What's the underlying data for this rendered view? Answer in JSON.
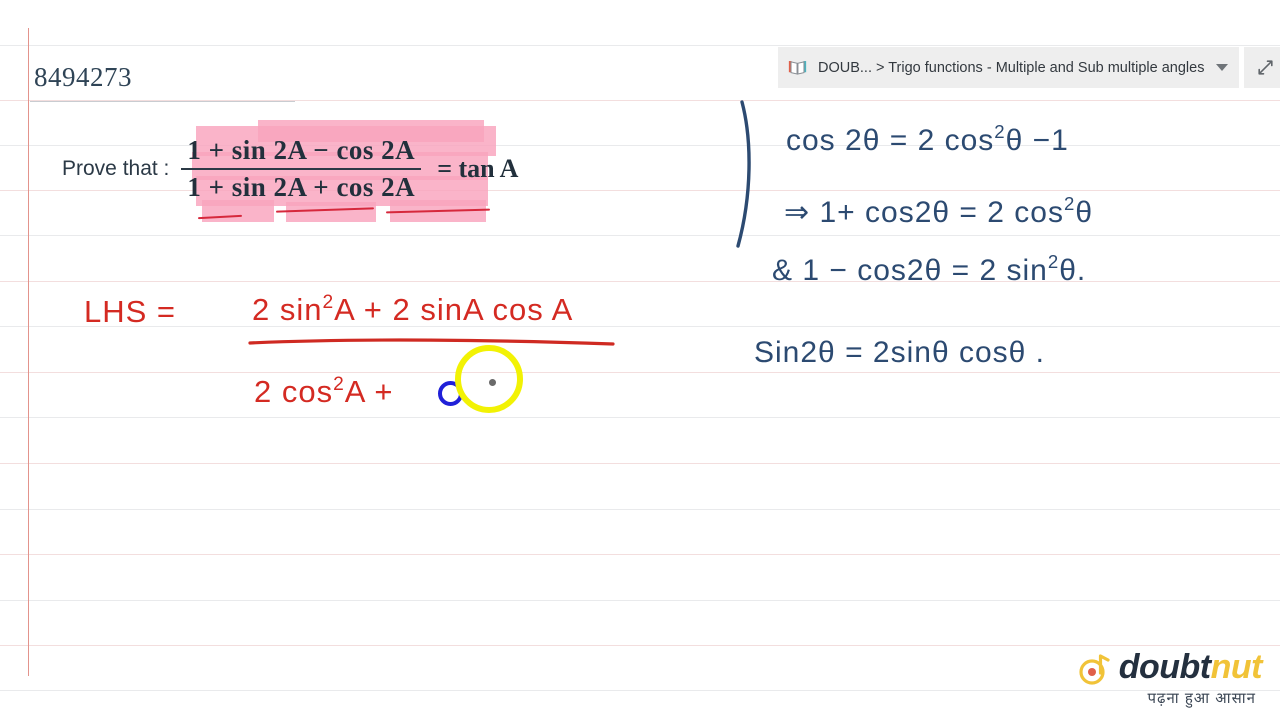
{
  "page": {
    "question_id": "8494273",
    "background": "#ffffff",
    "margin_line_color": "#e3938c",
    "rule_line_color": "#e9eaec"
  },
  "question": {
    "prove_label": "Prove that :",
    "numerator": "1 + sin 2A − cos 2A",
    "denominator": "1 + sin 2A + cos 2A",
    "right_side": "= tan A",
    "highlight_color": "#f9a3bd",
    "underline_color": "#d6283c"
  },
  "toolbar": {
    "book_icon": "book-icon",
    "breadcrumb": "DOUB... > Trigo functions - Multiple and Sub multiple angles",
    "caret_icon": "chevron-down-icon",
    "expand_icon": "expand-diagonal-icon",
    "background": "#eeeeee"
  },
  "solution": {
    "ink_color_red": "#d42a22",
    "lhs_label": "LHS =",
    "numerator": "2 sin²A + 2 sinA cosA",
    "denominator": "2 cos²A +",
    "num_part1": "2 sin",
    "num_sup1": "2",
    "num_part2": "A + 2 sinA cos A",
    "den_part1": "2 cos",
    "den_sup1": "2",
    "den_part2": "A +"
  },
  "formulas": {
    "ink_color_blue": "#2c4a71",
    "line1_a": "cos 2θ = 2 cos",
    "line1_sup": "2",
    "line1_b": "θ −1",
    "line2_a": "⇒  1+ cos2θ = 2 cos",
    "line2_sup": "2",
    "line2_b": "θ",
    "line3_a": "&  1 − cos2θ = 2 sin",
    "line3_sup": "2",
    "line3_b": "θ.",
    "line4": "Sin2θ = 2sinθ cosθ ."
  },
  "cursor": {
    "ring_color": "#f2f204",
    "dot_color": "#6a6a6a",
    "blue_mark_color": "#2020d8"
  },
  "logo": {
    "mark": "doubtnut-logo-mark",
    "name_part1": "doubt",
    "name_part2": "nut",
    "tagline": "पढ़ना हुआ आसान",
    "color_dark": "#24303f",
    "color_gold": "#f1c338"
  }
}
